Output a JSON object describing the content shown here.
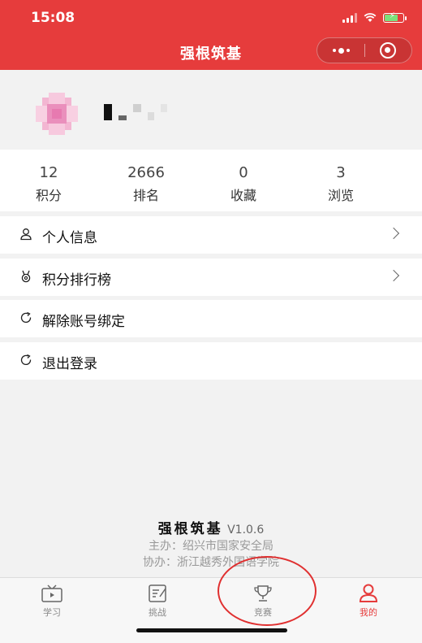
{
  "status_bar": {
    "time": "15:08"
  },
  "nav": {
    "title": "强根筑基"
  },
  "stats": [
    {
      "value": "12",
      "label": "积分"
    },
    {
      "value": "2666",
      "label": "排名"
    },
    {
      "value": "0",
      "label": "收藏"
    },
    {
      "value": "3",
      "label": "浏览"
    }
  ],
  "menu": [
    {
      "label": "个人信息",
      "icon": "person-icon"
    },
    {
      "label": "积分排行榜",
      "icon": "medal-icon"
    },
    {
      "label": "解除账号绑定",
      "icon": "refresh-icon"
    },
    {
      "label": "退出登录",
      "icon": "refresh-icon"
    }
  ],
  "footer": {
    "app_name": "强根筑基",
    "version": "V1.0.6",
    "host": "主办：绍兴市国家安全局",
    "co_host": "协办：浙江越秀外国语学院"
  },
  "tabs": [
    {
      "label": "学习",
      "icon": "tv-icon"
    },
    {
      "label": "挑战",
      "icon": "notepad-icon"
    },
    {
      "label": "竞赛",
      "icon": "trophy-icon"
    },
    {
      "label": "我的",
      "icon": "user-icon"
    }
  ],
  "colors": {
    "brand": "#e63c3c",
    "annotation": "#e03030"
  }
}
